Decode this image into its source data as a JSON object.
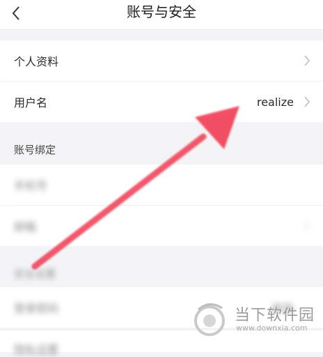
{
  "header": {
    "title": "账号与安全"
  },
  "rows": {
    "profile": {
      "label": "个人资料"
    },
    "username": {
      "label": "用户名",
      "value": "realize"
    }
  },
  "binding": {
    "section_title": "账号绑定",
    "phone_label": "手机号",
    "email_label": "邮箱"
  },
  "security": {
    "section_title": "安全设置",
    "password_label": "登录密码",
    "password_value": "修改",
    "more_label": "隐私设置"
  },
  "watermark": {
    "name": "当下软件园",
    "url": "www.downxia.com"
  },
  "colors": {
    "arrow": "#f1435a",
    "background": "#f4f4f6"
  }
}
